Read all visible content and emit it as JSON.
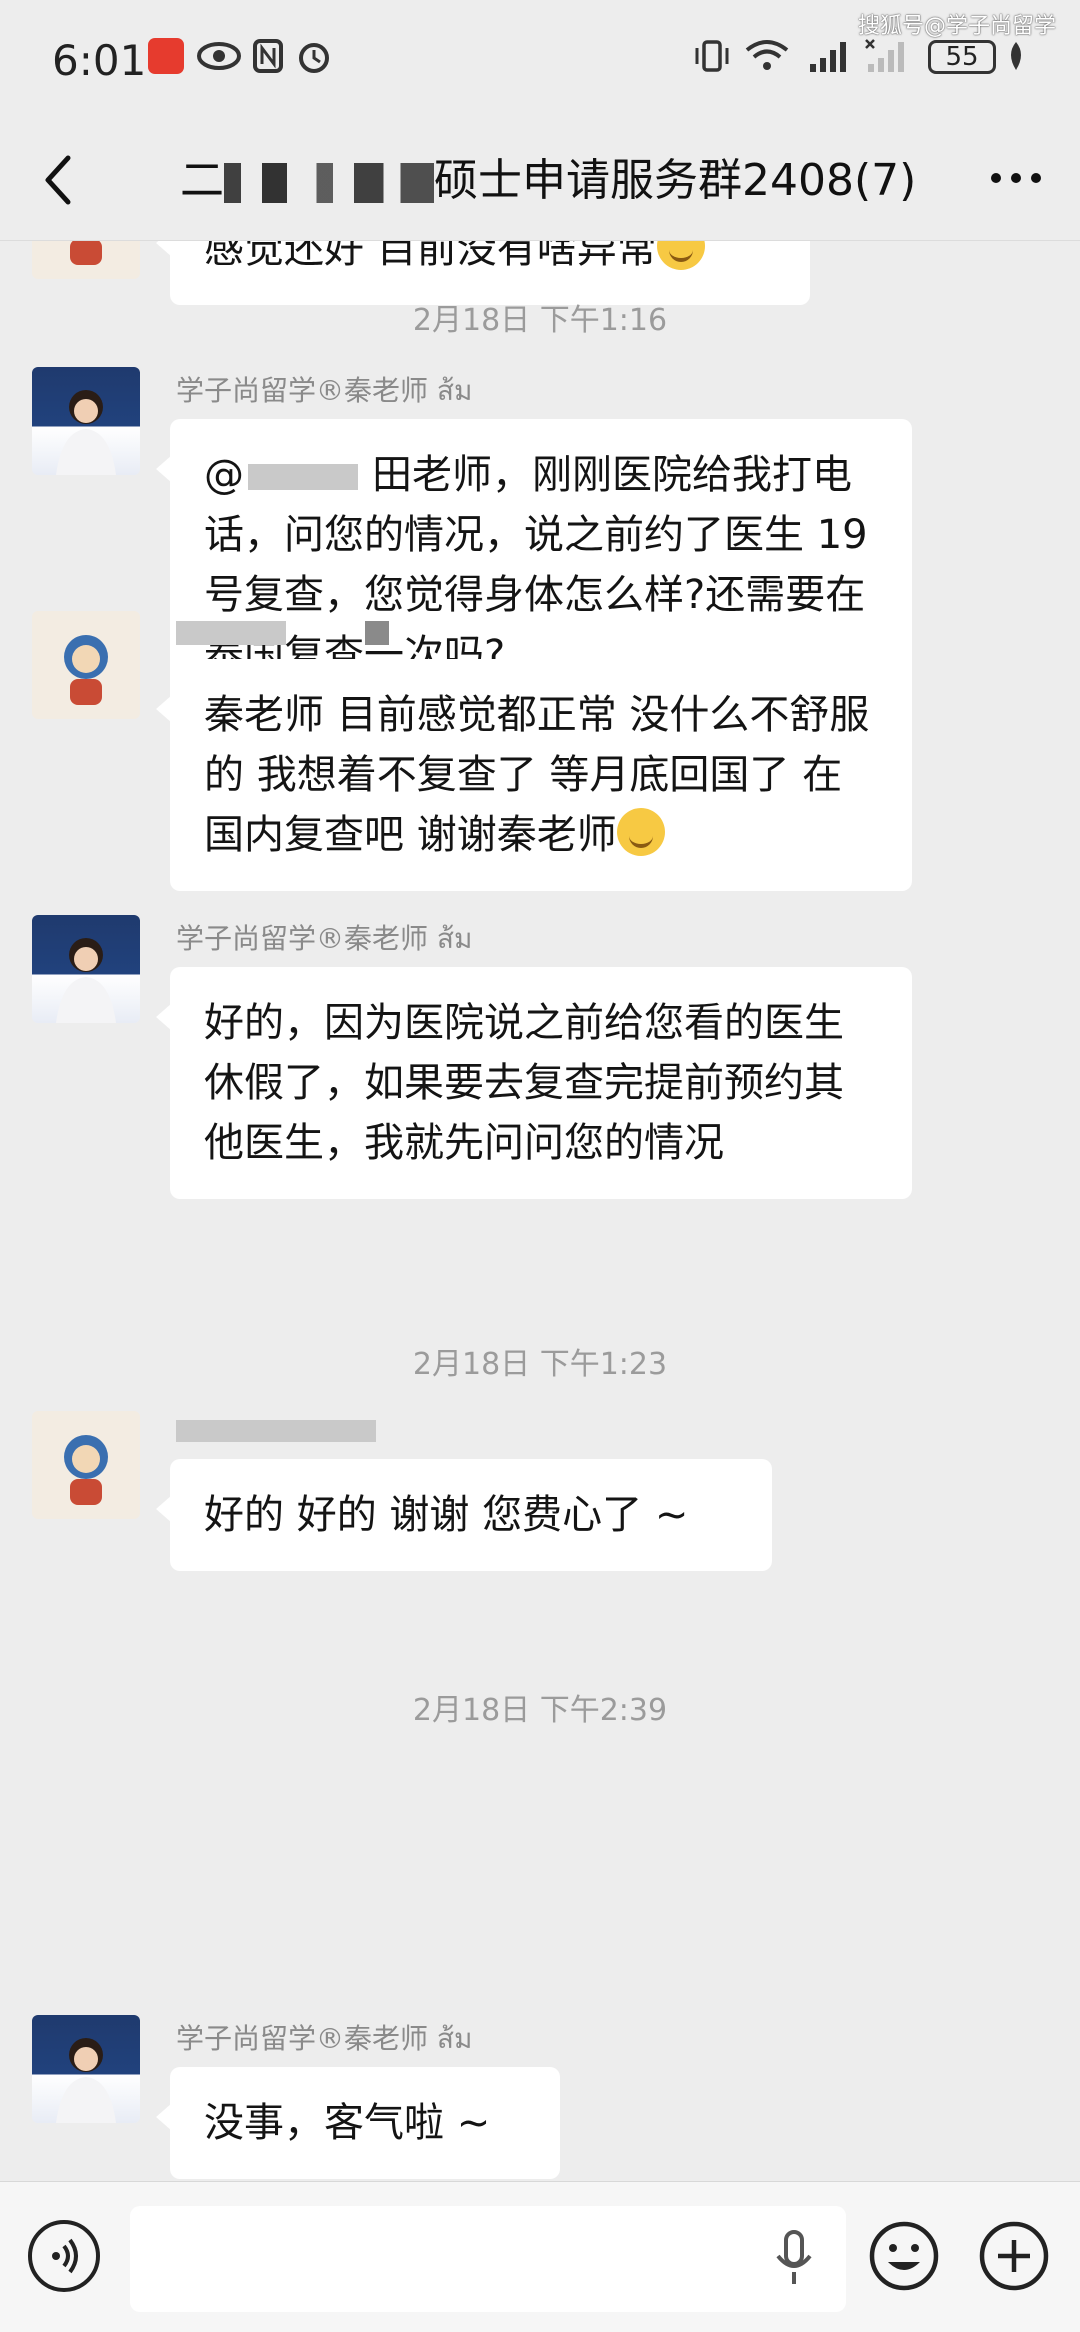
{
  "status_bar": {
    "time": "6:01",
    "battery": "55",
    "watermark": "搜狐号@学子尚留学"
  },
  "header": {
    "title_prefix": "二",
    "title_suffix": "硕士申请服务群2408(7)"
  },
  "messages": [
    {
      "type": "text",
      "sender": "",
      "text": "感觉还好 目前没有啥异常",
      "emoji": true
    },
    {
      "type": "time",
      "text": "2月18日 下午1:16"
    },
    {
      "type": "text",
      "sender": "学子尚留学®秦老师 ส้ม",
      "mention": "@",
      "text": "田老师，刚刚医院给我打电话，问您的情况，说之前约了医生 19 号复查，您觉得身体怎么样?还需要在泰国复查一次吗?"
    },
    {
      "type": "text",
      "sender": "",
      "text": "秦老师 目前感觉都正常 没什么不舒服的 我想着不复查了 等月底回国了 在国内复查吧 谢谢秦老师",
      "emoji": true
    },
    {
      "type": "text",
      "sender": "学子尚留学®秦老师 ส้ม",
      "text": "好的，因为医院说之前给您看的医生休假了，如果要去复查完提前预约其他医生，我就先问问您的情况"
    },
    {
      "type": "time",
      "text": "2月18日 下午1:23"
    },
    {
      "type": "text",
      "sender": "",
      "text": "好的 好的 谢谢 您费心了 ~"
    },
    {
      "type": "time",
      "text": "2月18日 下午2:39"
    },
    {
      "type": "text",
      "sender": "学子尚留学®秦老师 ส้ม",
      "text": "没事，客气啦 ~"
    }
  ],
  "colors": {
    "background": "#ededed",
    "bubble": "#ffffff",
    "timestamp": "#9b9b9b"
  }
}
